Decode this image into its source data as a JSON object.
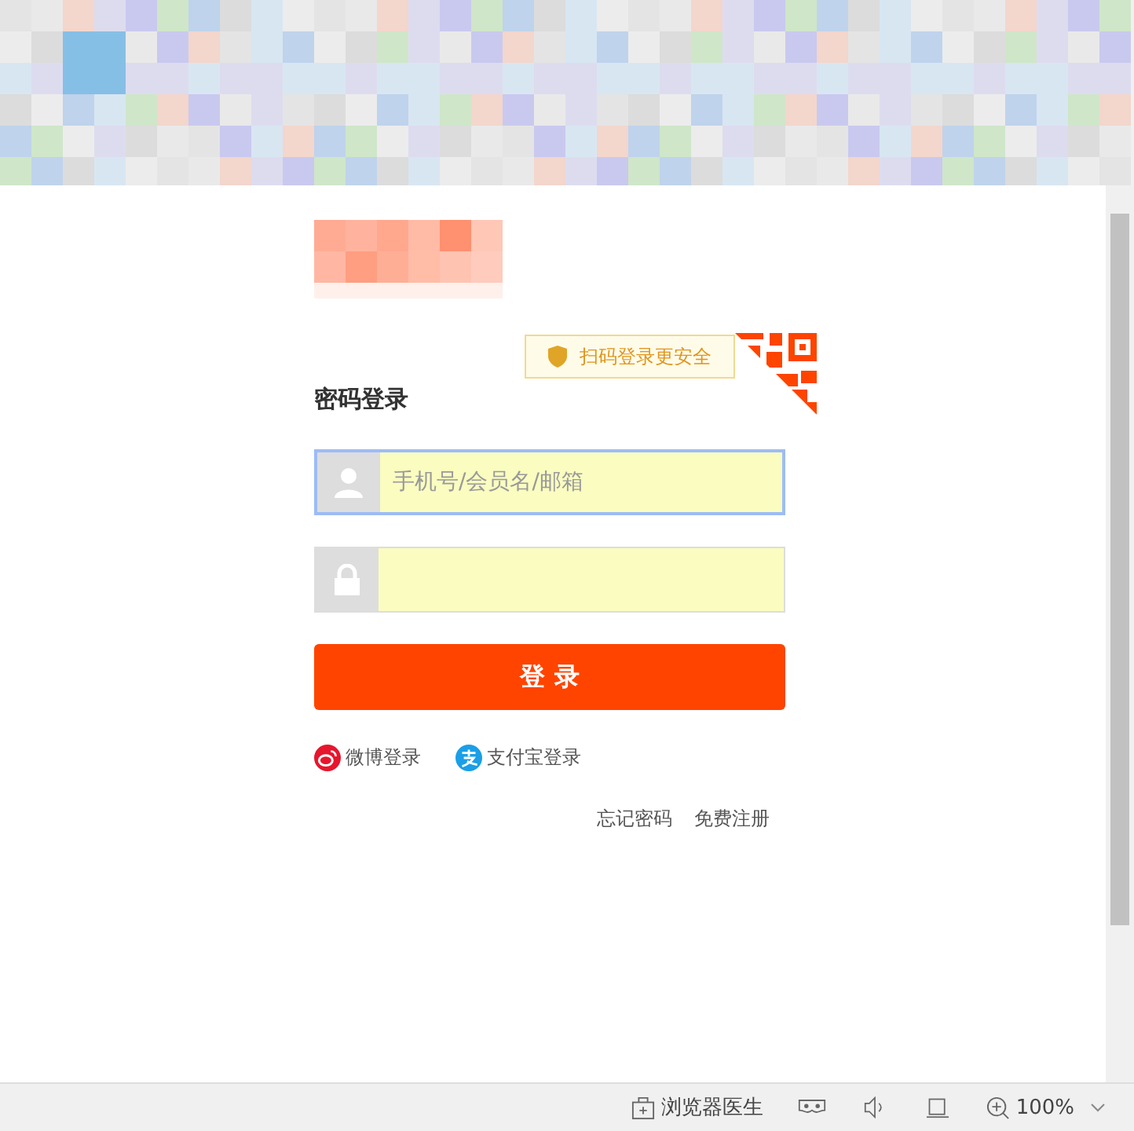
{
  "qr_tip": "扫码登录更安全",
  "title": "密码登录",
  "username": {
    "placeholder": "手机号/会员名/邮箱",
    "focused": true
  },
  "password": {
    "focused": false
  },
  "login_button": "登 录",
  "social": [
    {
      "label": "微博登录",
      "kind": "weibo"
    },
    {
      "label": "支付宝登录",
      "kind": "alipay"
    }
  ],
  "links": [
    "忘记密码",
    "免费注册"
  ],
  "status_bar": {
    "doctor": "浏览器医生",
    "zoom": "100%"
  }
}
